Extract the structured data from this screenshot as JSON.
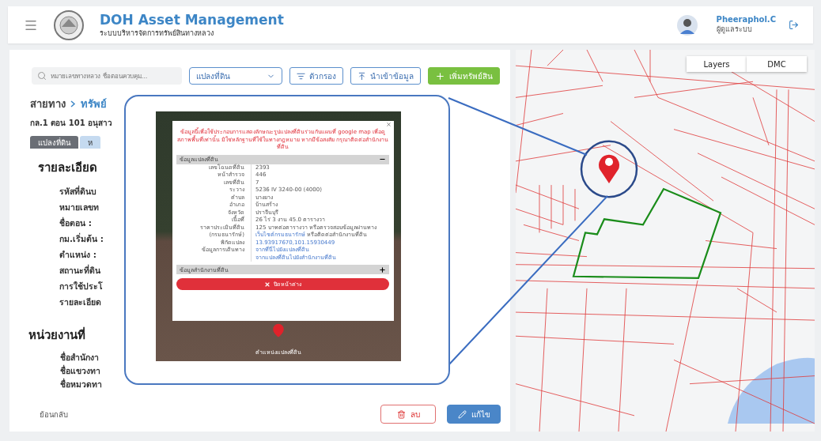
{
  "header": {
    "title": "DOH Asset Management",
    "subtitle": "ระบบบริหารจัดการทรัพย์สินทางหลวง",
    "user": {
      "name": "Pheeraphol.C",
      "role": "ผู้ดูแลระบบ"
    }
  },
  "toolbar": {
    "search": {
      "placeholder": "หมายเลขทางหลวง ชื่อตอนควบคุม..."
    },
    "select": {
      "value": "แปลงที่ดิน"
    },
    "buttons": [
      {
        "kind": "filter",
        "label": "ตัวกรอง"
      },
      {
        "kind": "import",
        "label": "นำเข้าข้อมูล"
      },
      {
        "kind": "add",
        "label": "เพิ่มทรัพย์สิน"
      }
    ]
  },
  "breadcrumb": [
    "สายทาง",
    "ทรัพย์"
  ],
  "route": "กล.1 ตอน 101 อนุสาว",
  "tabs": [
    {
      "label": "แปลงที่ดิน",
      "selected": true
    },
    {
      "label": "ห",
      "selected": false
    }
  ],
  "sections": [
    {
      "heading": "รายละเอียด",
      "fields": [
        "รหัสที่ดินบ",
        "หมายเลขท",
        "ชื่อตอน :",
        "กม.เริ่มต้น :",
        "ตำแหน่ง :",
        "สถานะที่ดิน",
        "การใช้ประโ",
        "รายละเอียด"
      ]
    },
    {
      "heading": "หน่วยงานที่",
      "fields": [
        "ชื่อสำนักงา",
        "ชื่อแขวงทา",
        "ชื่อหมวดทา"
      ]
    }
  ],
  "footer": {
    "back": "ย้อนกลับ",
    "buttons": [
      {
        "kind": "delete",
        "label": "ลบ"
      },
      {
        "kind": "edit",
        "label": "แก้ไข"
      }
    ]
  },
  "popup": {
    "notice": "ข้อมูลนี้เพื่อใช้ประกอบการแสดงลักษณะรูปแปลงที่ดินร่วมกับแผนที่ google map เพื่อดูสภาพพื้นที่เท่านั้น มิใช่หลักฐานที่ใช้ในทางกฎหมาย หากมีข้อสงสัย กรุณาติดต่อสำนักงานที่ดิน",
    "groups": [
      {
        "title": "ข้อมูลแปลงที่ดิน",
        "expanded": true,
        "rows": [
          {
            "label": [
              "เลขโฉนดที่ดิน"
            ],
            "lines": [
              [
                {
                  "text": "2393",
                  "link": false
                }
              ]
            ]
          },
          {
            "label": [
              "หน้าสำรวจ"
            ],
            "lines": [
              [
                {
                  "text": "446",
                  "link": false
                }
              ]
            ]
          },
          {
            "label": [
              "เลขที่ดิน"
            ],
            "lines": [
              [
                {
                  "text": "7",
                  "link": false
                }
              ]
            ]
          },
          {
            "label": [
              "ระวาง"
            ],
            "lines": [
              [
                {
                  "text": "5236 IV 3240-00 (4000)",
                  "link": false
                }
              ]
            ]
          },
          {
            "label": [
              "ตำบล"
            ],
            "lines": [
              [
                {
                  "text": "บางยาง",
                  "link": false
                }
              ]
            ]
          },
          {
            "label": [
              "อำเภอ"
            ],
            "lines": [
              [
                {
                  "text": "บ้านสร้าง",
                  "link": false
                }
              ]
            ]
          },
          {
            "label": [
              "จังหวัด"
            ],
            "lines": [
              [
                {
                  "text": "ปราจีนบุรี",
                  "link": false
                }
              ]
            ]
          },
          {
            "label": [
              "เนื้อที่"
            ],
            "lines": [
              [
                {
                  "text": "26 ไร่ 3 งาน 45.0 ตารางวา",
                  "link": false
                }
              ]
            ]
          },
          {
            "label": [
              "ราคาประเมินที่ดิน",
              "(กรมธนารักษ์)"
            ],
            "lines": [
              [
                {
                  "text": "125 บาทต่อตารางวา หรือตรวจสอบข้อมูลผ่านทาง",
                  "link": false
                }
              ],
              [
                {
                  "text": "เว็บไซต์กรมธนารักษ์",
                  "link": true
                },
                {
                  "text": " หรือติดต่อสำนักงานที่ดิน",
                  "link": false
                }
              ]
            ]
          },
          {
            "label": [
              "พิกัดแปลง"
            ],
            "lines": [
              [
                {
                  "text": "13.93917670,101.15930449",
                  "link": true
                }
              ]
            ]
          },
          {
            "label": [
              "ข้อมูลการเดินทาง"
            ],
            "lines": [
              [
                {
                  "text": "จากที่นี่ไปยังแปลงที่ดิน",
                  "link": true
                }
              ],
              [
                {
                  "text": "จากแปลงที่ดินไปยังสำนักงานที่ดิน",
                  "link": true
                }
              ]
            ]
          }
        ]
      },
      {
        "title": "ข้อมูลสำนักงานที่ดิน",
        "expanded": false
      }
    ],
    "close_button": "ปิดหน้าต่าง",
    "pin_label": "ตำแหน่งแปลงที่ดิน"
  },
  "map": {
    "buttons": [
      "Layers",
      "DMC"
    ]
  }
}
